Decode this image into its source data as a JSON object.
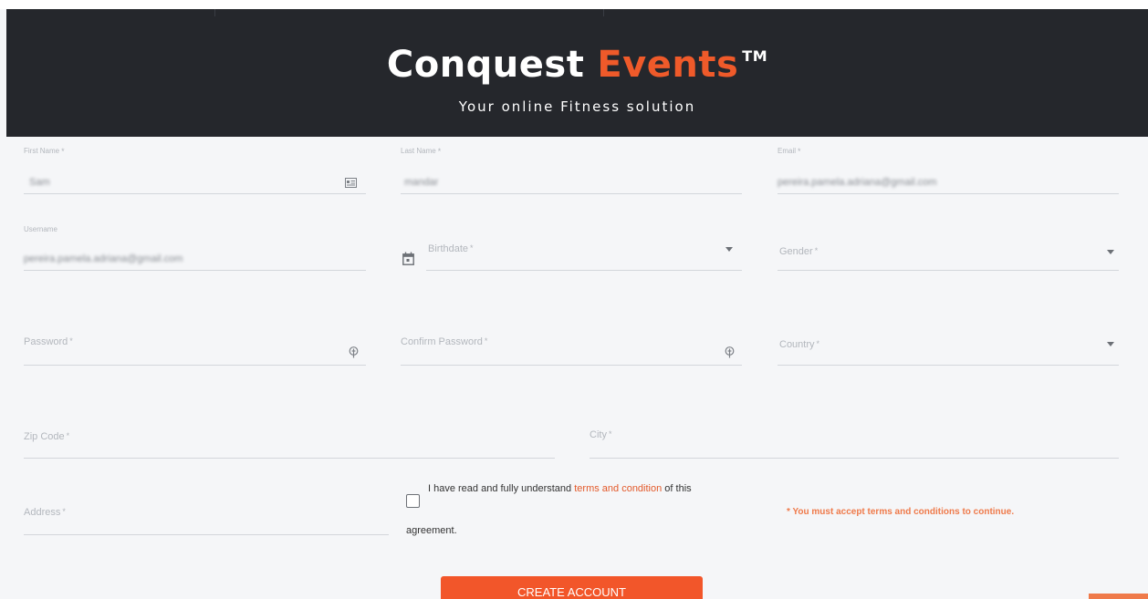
{
  "brand": {
    "word1": "Conquest",
    "word2": "Events",
    "tm": "TM",
    "tagline": "Your online Fitness solution",
    "accent_color": "#ef5a2a"
  },
  "form": {
    "first_name": {
      "label": "First Name",
      "required": "*",
      "value": "Sam",
      "icon": "id-card-icon"
    },
    "last_name": {
      "label": "Last Name",
      "required": "*",
      "value": "mandar"
    },
    "email": {
      "label": "Email",
      "required": "*",
      "value": "pereira.pamela.adriana@gmail.com"
    },
    "username": {
      "label": "Username",
      "value": "pereira.pamela.adriana@gmail.com"
    },
    "birthdate": {
      "label": "Birthdate",
      "required": "*",
      "icon": "calendar-icon"
    },
    "gender": {
      "label": "Gender",
      "required": "*"
    },
    "password": {
      "label": "Password",
      "required": "*",
      "icon": "key-icon"
    },
    "confirm_password": {
      "label": "Confirm Password",
      "required": "*",
      "icon": "key-icon"
    },
    "country": {
      "label": "Country",
      "required": "*"
    },
    "zip": {
      "label": "Zip Code",
      "required": "*"
    },
    "city": {
      "label": "City",
      "required": "*"
    },
    "address": {
      "label": "Address",
      "required": "*"
    }
  },
  "terms": {
    "text_before": "I have read and fully understand",
    "link": "terms and condition",
    "text_after": "of this",
    "text_line2": "agreement.",
    "warning": "* You must accept terms and conditions to continue."
  },
  "submit": {
    "label": "CREATE ACCOUNT",
    "color": "#f2562a"
  }
}
